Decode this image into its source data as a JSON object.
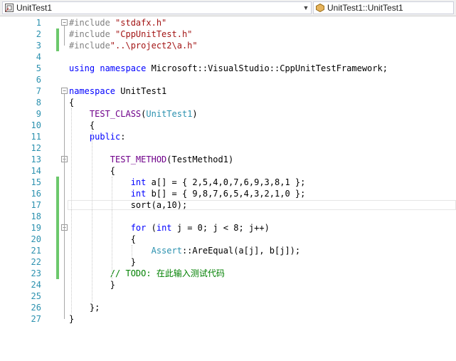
{
  "navbar": {
    "scope_combo": "UnitTest1",
    "member_combo": "UnitTest1::UnitTest1",
    "scope_icon": "project-icon",
    "member_icon": "class-icon",
    "dropdown_icon": "chevron-down-icon"
  },
  "editor": {
    "lines": [
      {
        "n": "1",
        "t": "#include \"stdafx.h\""
      },
      {
        "n": "2",
        "t": "#include \"CppUnitTest.h\""
      },
      {
        "n": "3",
        "t": "#include\"..\\project2\\a.h\""
      },
      {
        "n": "4",
        "t": ""
      },
      {
        "n": "5",
        "t": "using namespace Microsoft::VisualStudio::CppUnitTestFramework;"
      },
      {
        "n": "6",
        "t": ""
      },
      {
        "n": "7",
        "t": "namespace UnitTest1"
      },
      {
        "n": "8",
        "t": "{"
      },
      {
        "n": "9",
        "t": "    TEST_CLASS(UnitTest1)"
      },
      {
        "n": "10",
        "t": "    {"
      },
      {
        "n": "11",
        "t": "    public:"
      },
      {
        "n": "12",
        "t": ""
      },
      {
        "n": "13",
        "t": "        TEST_METHOD(TestMethod1)"
      },
      {
        "n": "14",
        "t": "        {"
      },
      {
        "n": "15",
        "t": "            int a[] = { 2,5,4,0,7,6,9,3,8,1 };"
      },
      {
        "n": "16",
        "t": "            int b[] = { 9,8,7,6,5,4,3,2,1,0 };"
      },
      {
        "n": "17",
        "t": "            sort(a,10);"
      },
      {
        "n": "18",
        "t": ""
      },
      {
        "n": "19",
        "t": "            for (int j = 0; j < 8; j++)"
      },
      {
        "n": "20",
        "t": "            {"
      },
      {
        "n": "21",
        "t": "                Assert::AreEqual(a[j], b[j]);"
      },
      {
        "n": "22",
        "t": "            }"
      },
      {
        "n": "23",
        "t": "        // TODO: 在此输入测试代码"
      },
      {
        "n": "24",
        "t": "        }"
      },
      {
        "n": "25",
        "t": ""
      },
      {
        "n": "26",
        "t": "    };"
      },
      {
        "n": "27",
        "t": "}"
      }
    ],
    "changed_lines": [
      "2",
      "3",
      "15",
      "16",
      "17",
      "18",
      "19",
      "20",
      "21",
      "22",
      "23"
    ],
    "fold_lines": [
      "1",
      "7",
      "13",
      "19"
    ],
    "current_line": "17",
    "colors": {
      "keyword": "#0000ff",
      "string": "#a31515",
      "preprocessor": "#808080",
      "comment": "#008000",
      "type": "#2b91af",
      "macro": "#6f008a",
      "line_number": "#2b91af",
      "change_bar": "#6cc86c"
    }
  }
}
